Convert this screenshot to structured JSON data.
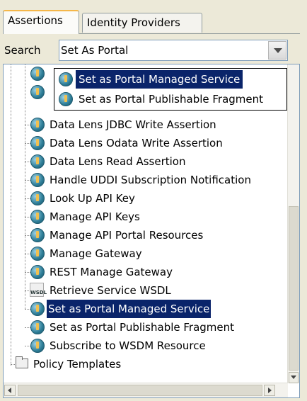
{
  "tabs": [
    {
      "label": "Assertions",
      "active": true
    },
    {
      "label": "Identity Providers",
      "active": false
    }
  ],
  "search": {
    "label": "Search",
    "value": "Set As Portal"
  },
  "suggestions": [
    {
      "label": "Set as Portal Managed Service",
      "selected": true,
      "icon": "assertion-icon"
    },
    {
      "label": "Set as Portal Publishable Fragment",
      "selected": false,
      "icon": "assertion-icon"
    }
  ],
  "tree": {
    "items": [
      {
        "label": "Data Lens JDBC Write Assertion",
        "icon": "assertion-icon"
      },
      {
        "label": "Data Lens Odata Write Assertion",
        "icon": "assertion-icon"
      },
      {
        "label": "Data Lens Read Assertion",
        "icon": "assertion-icon"
      },
      {
        "label": "Handle UDDI Subscription Notification",
        "icon": "assertion-icon"
      },
      {
        "label": "Look Up API Key",
        "icon": "assertion-icon"
      },
      {
        "label": "Manage API Keys",
        "icon": "assertion-icon"
      },
      {
        "label": "Manage API Portal Resources",
        "icon": "assertion-icon"
      },
      {
        "label": "Manage Gateway",
        "icon": "assertion-icon"
      },
      {
        "label": "REST Manage Gateway",
        "icon": "assertion-icon"
      },
      {
        "label": "Retrieve Service WSDL",
        "icon": "wsdl-icon",
        "icon_text": "WSDL"
      },
      {
        "label": "Set as Portal Managed Service",
        "icon": "assertion-icon",
        "selected": true
      },
      {
        "label": "Set as Portal Publishable Fragment",
        "icon": "assertion-icon"
      },
      {
        "label": "Subscribe to WSDM Resource",
        "icon": "assertion-icon"
      }
    ],
    "folder": {
      "label": "Policy Templates",
      "icon": "folder-icon"
    }
  }
}
